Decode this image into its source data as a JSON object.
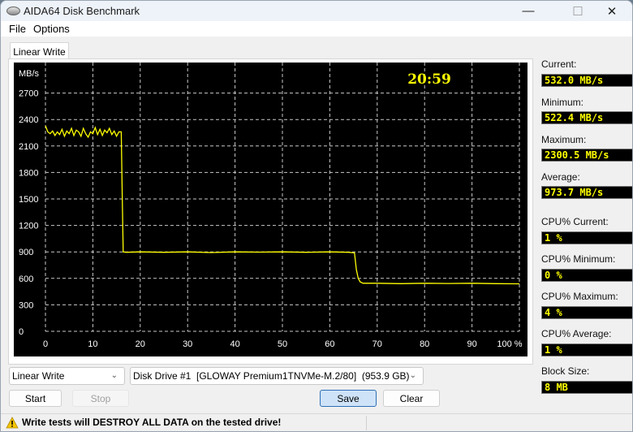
{
  "window": {
    "title": "AIDA64 Disk Benchmark",
    "controls": {
      "minimize": "—",
      "maximize": "☐",
      "close": "✕"
    }
  },
  "menu": [
    "File",
    "Options"
  ],
  "tab": {
    "label": "Linear Write"
  },
  "chart_data": {
    "type": "line",
    "title": "",
    "timer": "20:59",
    "ylabel": "MB/s",
    "xlabel": "",
    "xlim": [
      0,
      100
    ],
    "ylim": [
      0,
      3000
    ],
    "x_ticks": [
      "0",
      "10",
      "20",
      "30",
      "40",
      "50",
      "60",
      "70",
      "80",
      "90",
      "100 %"
    ],
    "y_ticks": [
      "0",
      "300",
      "600",
      "900",
      "1200",
      "1500",
      "1800",
      "2100",
      "2400",
      "2700"
    ],
    "grid": true,
    "series": [
      {
        "name": "Linear Write",
        "color": "#ffff00",
        "x": [
          0,
          0.5,
          1,
          1.5,
          2,
          2.5,
          3,
          3.5,
          4,
          4.5,
          5,
          5.5,
          6,
          6.5,
          7,
          7.5,
          8,
          8.5,
          9,
          9.5,
          10,
          10.5,
          11,
          11.5,
          12,
          12.5,
          13,
          13.5,
          14,
          14.5,
          15,
          15.5,
          16,
          16.2,
          16.4,
          17,
          20,
          25,
          30,
          35,
          40,
          45,
          50,
          55,
          60,
          64,
          65.2,
          65.6,
          66,
          66.4,
          67,
          70,
          75,
          80,
          85,
          90,
          95,
          100
        ],
        "y": [
          2330,
          2260,
          2240,
          2270,
          2220,
          2260,
          2230,
          2290,
          2210,
          2270,
          2240,
          2300,
          2220,
          2280,
          2260,
          2210,
          2300,
          2240,
          2200,
          2260,
          2240,
          2310,
          2230,
          2290,
          2220,
          2280,
          2250,
          2300,
          2230,
          2270,
          2210,
          2260,
          2260,
          1550,
          900,
          895,
          900,
          895,
          900,
          893,
          900,
          897,
          900,
          895,
          900,
          895,
          890,
          700,
          600,
          560,
          545,
          545,
          540,
          545,
          542,
          545,
          540,
          538
        ]
      }
    ]
  },
  "stats": {
    "current_label": "Current:",
    "current": "532.0 MB/s",
    "minimum_label": "Minimum:",
    "minimum": "522.4 MB/s",
    "maximum_label": "Maximum:",
    "maximum": "2300.5 MB/s",
    "average_label": "Average:",
    "average": "973.7 MB/s",
    "cpu_current_label": "CPU% Current:",
    "cpu_current": "1 %",
    "cpu_minimum_label": "CPU% Minimum:",
    "cpu_minimum": "0 %",
    "cpu_maximum_label": "CPU% Maximum:",
    "cpu_maximum": "4 %",
    "cpu_average_label": "CPU% Average:",
    "cpu_average": "1 %",
    "block_size_label": "Block Size:",
    "block_size": "8 MB"
  },
  "controls": {
    "test_select": "Linear Write",
    "drive_select": "Disk Drive #1  [GLOWAY Premium1TNVMe-M.2/80]  (953.9 GB)",
    "start": "Start",
    "stop": "Stop",
    "save": "Save",
    "clear": "Clear"
  },
  "status": {
    "message": "Write tests will DESTROY ALL DATA on the tested drive!"
  }
}
